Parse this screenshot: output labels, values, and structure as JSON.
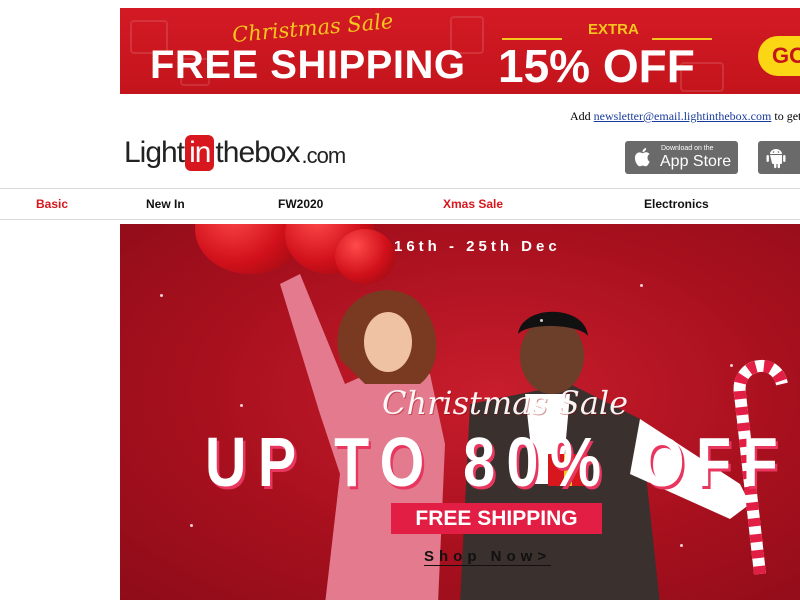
{
  "top_banner": {
    "script": "Christmas Sale",
    "headline": "FREE SHIPPING",
    "extra_label": "EXTRA",
    "discount": "15% OFF",
    "go_label": "GO"
  },
  "newsletter": {
    "prefix": "Add",
    "email": "newsletter@email.lightinthebox.com",
    "suffix": "to get"
  },
  "logo": {
    "part1": "Light",
    "part2": "in",
    "part3": "thebox",
    "part4": ".com"
  },
  "apps": {
    "appstore_small": "Download on the",
    "appstore_big": "App Store",
    "icons": [
      "apple-icon",
      "android-icon"
    ]
  },
  "nav": {
    "items": [
      {
        "label": "Basic",
        "accent": true
      },
      {
        "label": "New In",
        "accent": false
      },
      {
        "label": "FW2020",
        "accent": false
      },
      {
        "label": "Xmas Sale",
        "accent": true
      },
      {
        "label": "Electronics",
        "accent": false
      }
    ]
  },
  "hero": {
    "date": "16th - 25th Dec",
    "script": "Christmas Sale",
    "headline": "UP TO 80% OFF",
    "badge": "FREE SHIPPING",
    "cta": "Shop Now>"
  },
  "colors": {
    "brand_red": "#d8161d",
    "banner_yellow": "#f6c61d",
    "hero_red": "#a8101e",
    "badge_pink": "#e31e44"
  }
}
